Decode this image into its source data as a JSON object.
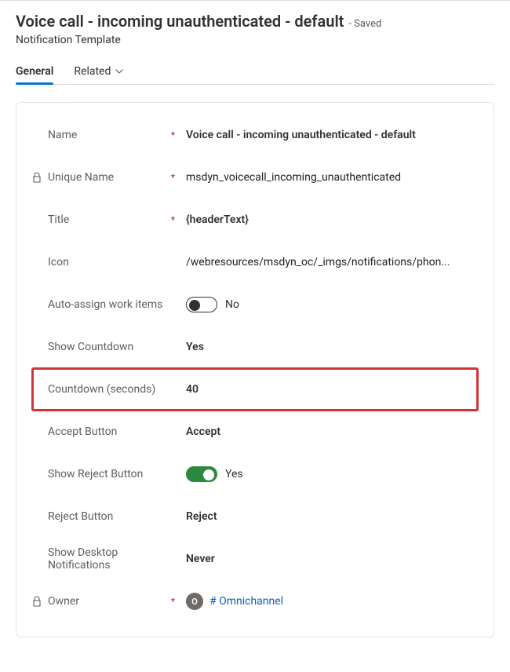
{
  "header": {
    "title": "Voice call - incoming unauthenticated - default",
    "savedSuffix": "- Saved",
    "subtitle": "Notification Template"
  },
  "tabs": {
    "general": "General",
    "related": "Related"
  },
  "fields": {
    "name": {
      "label": "Name",
      "value": "Voice call - incoming unauthenticated - default"
    },
    "uniqueName": {
      "label": "Unique Name",
      "value": "msdyn_voicecall_incoming_unauthenticated"
    },
    "title": {
      "label": "Title",
      "value": "{headerText}"
    },
    "icon": {
      "label": "Icon",
      "value": "/webresources/msdyn_oc/_imgs/notifications/phon..."
    },
    "autoAssign": {
      "label": "Auto-assign work items",
      "value": "No",
      "state": "off"
    },
    "showCountdown": {
      "label": "Show Countdown",
      "value": "Yes"
    },
    "countdown": {
      "label": "Countdown (seconds)",
      "value": "40"
    },
    "acceptButton": {
      "label": "Accept Button",
      "value": "Accept"
    },
    "showReject": {
      "label": "Show Reject Button",
      "value": "Yes",
      "state": "on"
    },
    "rejectButton": {
      "label": "Reject Button",
      "value": "Reject"
    },
    "showDesktop": {
      "label": "Show Desktop Notifications",
      "value": "Never"
    },
    "owner": {
      "label": "Owner",
      "initial": "O",
      "link": "# Omnichannel"
    }
  }
}
